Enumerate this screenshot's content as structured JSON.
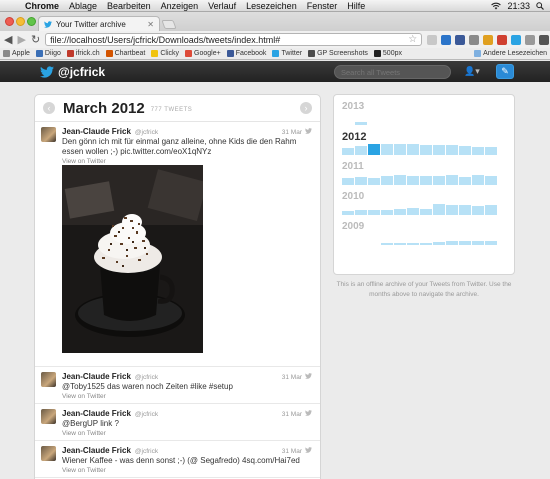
{
  "menubar": {
    "items": [
      "Chrome",
      "Ablage",
      "Bearbeiten",
      "Anzeigen",
      "Verlauf",
      "Lesezeichen",
      "Fenster",
      "Hilfe"
    ],
    "time": "21:33"
  },
  "browser": {
    "tab_title": "Your Twitter archive",
    "url": "file://localhost/Users/jcfrick/Downloads/tweets/index.html#",
    "bookmarks": [
      {
        "label": "Apple",
        "color": "#8a8a8a"
      },
      {
        "label": "Diigo",
        "color": "#3b6fb6"
      },
      {
        "label": "ifrick.ch",
        "color": "#c0392b"
      },
      {
        "label": "Chartbeat",
        "color": "#d35400"
      },
      {
        "label": "Clicky",
        "color": "#f1c40f"
      },
      {
        "label": "Google+",
        "color": "#dd4b39"
      },
      {
        "label": "Facebook",
        "color": "#3b5998"
      },
      {
        "label": "Twitter",
        "color": "#2aa3e3"
      },
      {
        "label": "GP Screenshots",
        "color": "#4a4a4a"
      },
      {
        "label": "500px",
        "color": "#222222"
      }
    ],
    "other_bookmarks": "Andere Lesezeichen"
  },
  "twitter": {
    "handle": "@jcfrick",
    "search_placeholder": "Search all Tweets"
  },
  "column": {
    "month": "March 2012",
    "count": "777 TWEETS"
  },
  "tweets": [
    {
      "name": "Jean-Claude Frick",
      "user": "@jcfrick",
      "date": "31 Mar",
      "text": "Den gönn ich mit für einmal ganz alleine, ohne Kids die den Rahm essen wollen ;-) pic.twitter.com/eoX1qNYz",
      "link": "View on Twitter"
    },
    {
      "name": "Jean-Claude Frick",
      "user": "@jcfrick",
      "date": "31 Mar",
      "text": "@Toby1525 das waren noch Zeiten #like #setup",
      "link": "View on Twitter"
    },
    {
      "name": "Jean-Claude Frick",
      "user": "@jcfrick",
      "date": "31 Mar",
      "text": "@BergUP link ?",
      "link": "View on Twitter"
    },
    {
      "name": "Jean-Claude Frick",
      "user": "@jcfrick",
      "date": "31 Mar",
      "text": "Wiener Kaffee - was denn sonst ;-) (@ Segafredo) 4sq.com/Hai7ed",
      "link": "View on Twitter"
    }
  ],
  "years": [
    {
      "label": "2013",
      "active": false,
      "bars": [
        0,
        0.25,
        0,
        0,
        0,
        0,
        0,
        0,
        0,
        0,
        0,
        0
      ]
    },
    {
      "label": "2012",
      "active": true,
      "bars": [
        0.55,
        0.75,
        0.95,
        0.95,
        0.9,
        0.9,
        0.8,
        0.85,
        0.8,
        0.75,
        0.7,
        0.7
      ]
    },
    {
      "label": "2011",
      "active": false,
      "bars": [
        0.55,
        0.65,
        0.6,
        0.75,
        0.8,
        0.75,
        0.75,
        0.75,
        0.8,
        0.7,
        0.85,
        0.75
      ]
    },
    {
      "label": "2010",
      "active": false,
      "bars": [
        0.3,
        0.4,
        0.45,
        0.45,
        0.5,
        0.55,
        0.5,
        0.9,
        0.85,
        0.8,
        0.75,
        0.8
      ]
    },
    {
      "label": "2009",
      "active": false,
      "bars": [
        0,
        0,
        0,
        0.1,
        0.15,
        0.15,
        0.2,
        0.25,
        0.3,
        0.3,
        0.35,
        0.35
      ]
    }
  ],
  "selected_month_index": 2,
  "info_text": "This is an offline archive of your Tweets from Twitter. Use the months above to navigate the archive.",
  "colors": {
    "twitter_blue": "#2aa3e3",
    "bar": "#b7e1f6",
    "nav": "#2b2b2b"
  }
}
